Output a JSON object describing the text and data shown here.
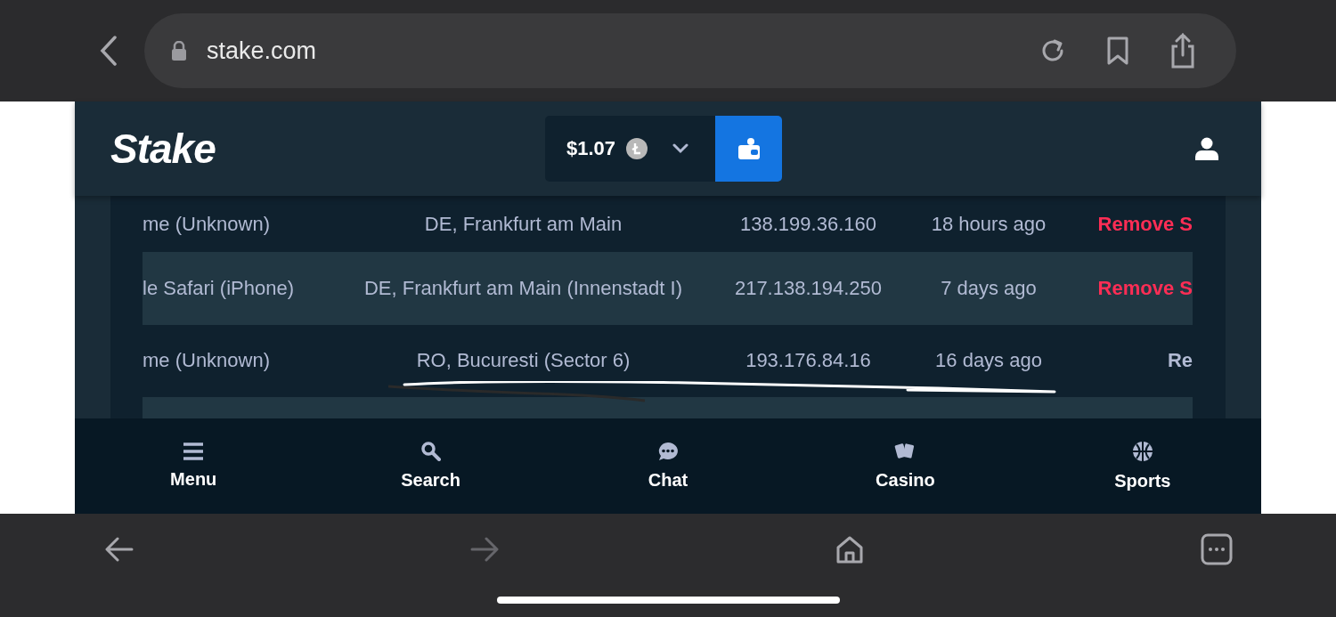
{
  "browser": {
    "url": "stake.com",
    "forward_disabled": true
  },
  "header": {
    "logo": "Stake",
    "balance": "$1.07"
  },
  "sessions": [
    {
      "device": "me (Unknown)",
      "location": "DE, Frankfurt am Main",
      "ip": "138.199.36.160",
      "last_used": "18 hours ago",
      "action": {
        "label": "Remove S",
        "kind": "danger"
      }
    },
    {
      "device": "le Safari (iPhone)",
      "location": "DE, Frankfurt am Main (Innenstadt I)",
      "ip": "217.138.194.250",
      "last_used": "7 days ago",
      "action": {
        "label": "Remove S",
        "kind": "danger"
      }
    },
    {
      "device": "me (Unknown)",
      "location": "RO, Bucuresti (Sector 6)",
      "ip": "193.176.84.16",
      "last_used": "16 days ago",
      "action": {
        "label": "Re",
        "kind": "plain"
      }
    }
  ],
  "bottom_nav": [
    {
      "label": "Menu",
      "kind": "menu"
    },
    {
      "label": "Search",
      "kind": "search"
    },
    {
      "label": "Chat",
      "kind": "chat"
    },
    {
      "label": "Casino",
      "kind": "casino"
    },
    {
      "label": "Sports",
      "kind": "sports"
    }
  ]
}
